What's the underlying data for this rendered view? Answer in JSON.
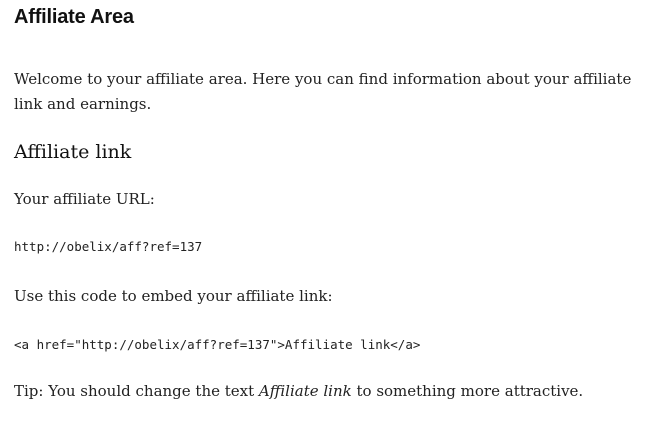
{
  "page": {
    "title": "Affiliate Area",
    "intro": "Welcome to your affiliate area. Here you can find information about your affiliate link and earnings."
  },
  "affiliate_link": {
    "heading": "Affiliate link",
    "url_label": "Your affiliate URL:",
    "url_value": "http://obelix/aff?ref=137",
    "embed_label": "Use this code to embed your affiliate link:",
    "embed_code": "<a href=\"http://obelix/aff?ref=137\">Affiliate link</a>",
    "tip_prefix": "Tip: You should change the text ",
    "tip_emphasis": "Affiliate link",
    "tip_suffix": " to something more attractive."
  }
}
